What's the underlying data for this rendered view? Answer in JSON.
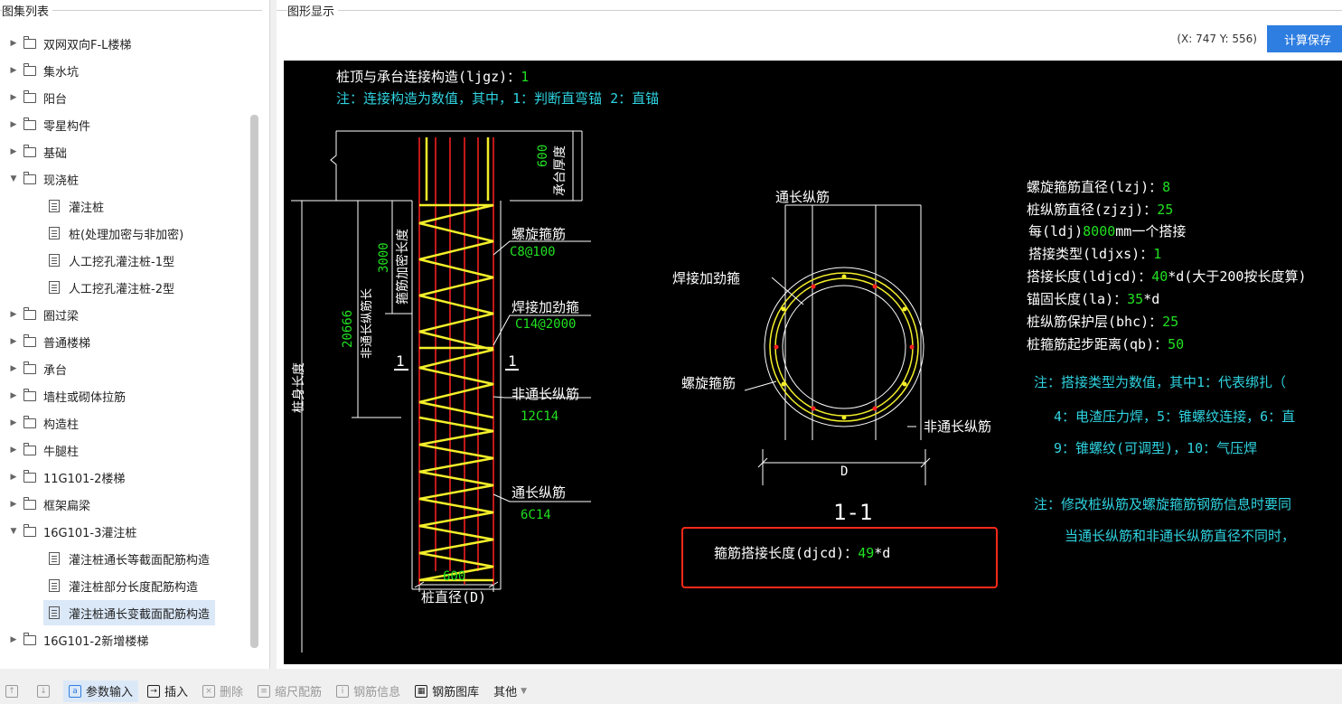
{
  "left_panel": {
    "title": "图集列表",
    "items": [
      {
        "label": "双网双向F-L楼梯",
        "type": "folder",
        "expanded": false
      },
      {
        "label": "集水坑",
        "type": "folder",
        "expanded": false
      },
      {
        "label": "阳台",
        "type": "folder",
        "expanded": false
      },
      {
        "label": "零星构件",
        "type": "folder",
        "expanded": false
      },
      {
        "label": "基础",
        "type": "folder",
        "expanded": false
      },
      {
        "label": "现浇桩",
        "type": "folder",
        "expanded": true
      },
      {
        "label": "灌注桩",
        "type": "doc"
      },
      {
        "label": "桩(处理加密与非加密)",
        "type": "doc"
      },
      {
        "label": "人工挖孔灌注桩-1型",
        "type": "doc"
      },
      {
        "label": "人工挖孔灌注桩-2型",
        "type": "doc"
      },
      {
        "label": "圈过梁",
        "type": "folder",
        "expanded": false
      },
      {
        "label": "普通楼梯",
        "type": "folder",
        "expanded": false
      },
      {
        "label": "承台",
        "type": "folder",
        "expanded": false
      },
      {
        "label": "墙柱或砌体拉筋",
        "type": "folder",
        "expanded": false
      },
      {
        "label": "构造柱",
        "type": "folder",
        "expanded": false
      },
      {
        "label": "牛腿柱",
        "type": "folder",
        "expanded": false
      },
      {
        "label": "11G101-2楼梯",
        "type": "folder",
        "expanded": false
      },
      {
        "label": "框架扁梁",
        "type": "folder",
        "expanded": false
      },
      {
        "label": "16G101-3灌注桩",
        "type": "folder",
        "expanded": true
      },
      {
        "label": "灌注桩通长等截面配筋构造",
        "type": "doc"
      },
      {
        "label": "灌注桩部分长度配筋构造",
        "type": "doc"
      },
      {
        "label": "灌注桩通长变截面配筋构造",
        "type": "doc",
        "selected": true
      },
      {
        "label": "16G101-2新增楼梯",
        "type": "folder",
        "expanded": false
      }
    ]
  },
  "right_panel": {
    "title": "图形显示",
    "coord": "(X: 747 Y: 556)",
    "calc_button": "计算保存"
  },
  "drawing": {
    "line1_label": "桩顶与承台连接构造(ljgz)：",
    "line1_value": "1",
    "note1": "注：连接构造为数值，其中，1：判断直弯锚      2：直锚",
    "dim_600_top": "600",
    "cap_thickness": "承台厚度",
    "dim_3000": "3000",
    "dense_length": "箍筋加密长度",
    "dim_20666": "20666",
    "non_long_len": "非通长纵筋长",
    "pile_length": "桩身长度",
    "sec_mark_left": "1",
    "sec_mark_right": "1",
    "spiral_label": "螺旋箍筋",
    "spiral_spec": "C8@100",
    "weld_label": "焊接加劲箍",
    "weld_spec": "C14@2000",
    "non_long_label": "非通长纵筋",
    "non_long_spec": "12C14",
    "long_label": "通长纵筋",
    "long_spec": "6C14",
    "dim_600_bottom": "600",
    "pile_diameter": "桩直径(D)",
    "sec_long": "通长纵筋",
    "sec_weld": "焊接加劲箍",
    "sec_spiral": "螺旋箍筋",
    "sec_non_long": "非通长纵筋",
    "sec_D": "D",
    "sec_title": "1-1",
    "lap_label": "箍筋搭接长度(djcd)：",
    "lap_value": "49",
    "lap_unit": "*d",
    "params": [
      {
        "label": "螺旋箍筋直径(lzj)：",
        "value": "8",
        "suffix": ""
      },
      {
        "label": "桩纵筋直径(zjzj)：",
        "value": "25",
        "suffix": ""
      },
      {
        "label": "每(ldj)",
        "value": "8000",
        "suffix": "mm一个搭接"
      },
      {
        "label": "搭接类型(ldjxs)：",
        "value": "1",
        "suffix": ""
      },
      {
        "label": "搭接长度(ldjcd)：",
        "value": "40",
        "suffix": "*d(大于200按长度算)"
      },
      {
        "label": "锚固长度(la)：",
        "value": "35",
        "suffix": "*d"
      },
      {
        "label": "桩纵筋保护层(bhc)：",
        "value": "25",
        "suffix": ""
      },
      {
        "label": "桩箍筋起步距离(qb)：",
        "value": "50",
        "suffix": ""
      }
    ],
    "note2_line1": "注：搭接类型为数值，其中1：代表绑扎（",
    "note2_line2": "4：电渣压力焊，5：锥螺纹连接，6：直",
    "note2_line3": "9：锥螺纹(可调型)，10：气压焊",
    "note3_line1": "注：修改桩纵筋及螺旋箍筋钢筋信息时要同",
    "note3_line2": "当通长纵筋和非通长纵筋直径不同时，"
  },
  "toolbar": {
    "items": [
      {
        "label": "",
        "icon": "up-arrow-icon"
      },
      {
        "label": "",
        "icon": "down-arrow-icon"
      },
      {
        "label": "参数输入",
        "icon": "param-input-icon"
      },
      {
        "label": "插入",
        "icon": "insert-icon"
      },
      {
        "label": "删除",
        "icon": "delete-icon"
      },
      {
        "label": "缩尺配筋",
        "icon": "scale-rebar-icon"
      },
      {
        "label": "钢筋信息",
        "icon": "rebar-info-icon"
      },
      {
        "label": "钢筋图库",
        "icon": "rebar-library-icon"
      },
      {
        "label": "其他",
        "icon": "chevron-down-icon"
      }
    ]
  }
}
